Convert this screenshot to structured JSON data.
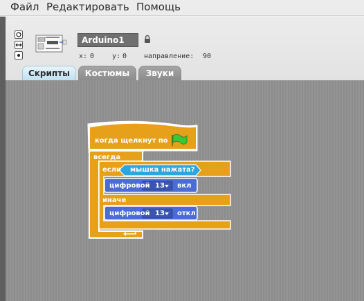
{
  "menu": {
    "file": "Файл",
    "edit": "Редактировать",
    "help": "Помощь"
  },
  "sprite": {
    "name": "Arduino1",
    "x_label": "x:",
    "x_value": "0",
    "y_label": "y:",
    "y_value": "0",
    "direction_label": "направление:",
    "direction_value": "90"
  },
  "tabs": {
    "scripts": "Скрипты",
    "costumes": "Костюмы",
    "sounds": "Звуки"
  },
  "script": {
    "hat": "когда щелкнут по",
    "forever": "всегда",
    "if": "если",
    "condition": "мышка нажата?",
    "digital1": "цифровой",
    "pin1": "13",
    "state1": "вкл",
    "else": "иначе",
    "digital2": "цифровой",
    "pin2": "13",
    "state2": "откл"
  },
  "colors": {
    "control": "#e6a019",
    "sensing": "#2ca5e2",
    "motor": "#4a6cd4",
    "flag": "#3ec63a"
  },
  "icons": {
    "flag": "green-flag-icon",
    "lock": "lock-icon",
    "arrow": "loop-arrow-icon"
  }
}
